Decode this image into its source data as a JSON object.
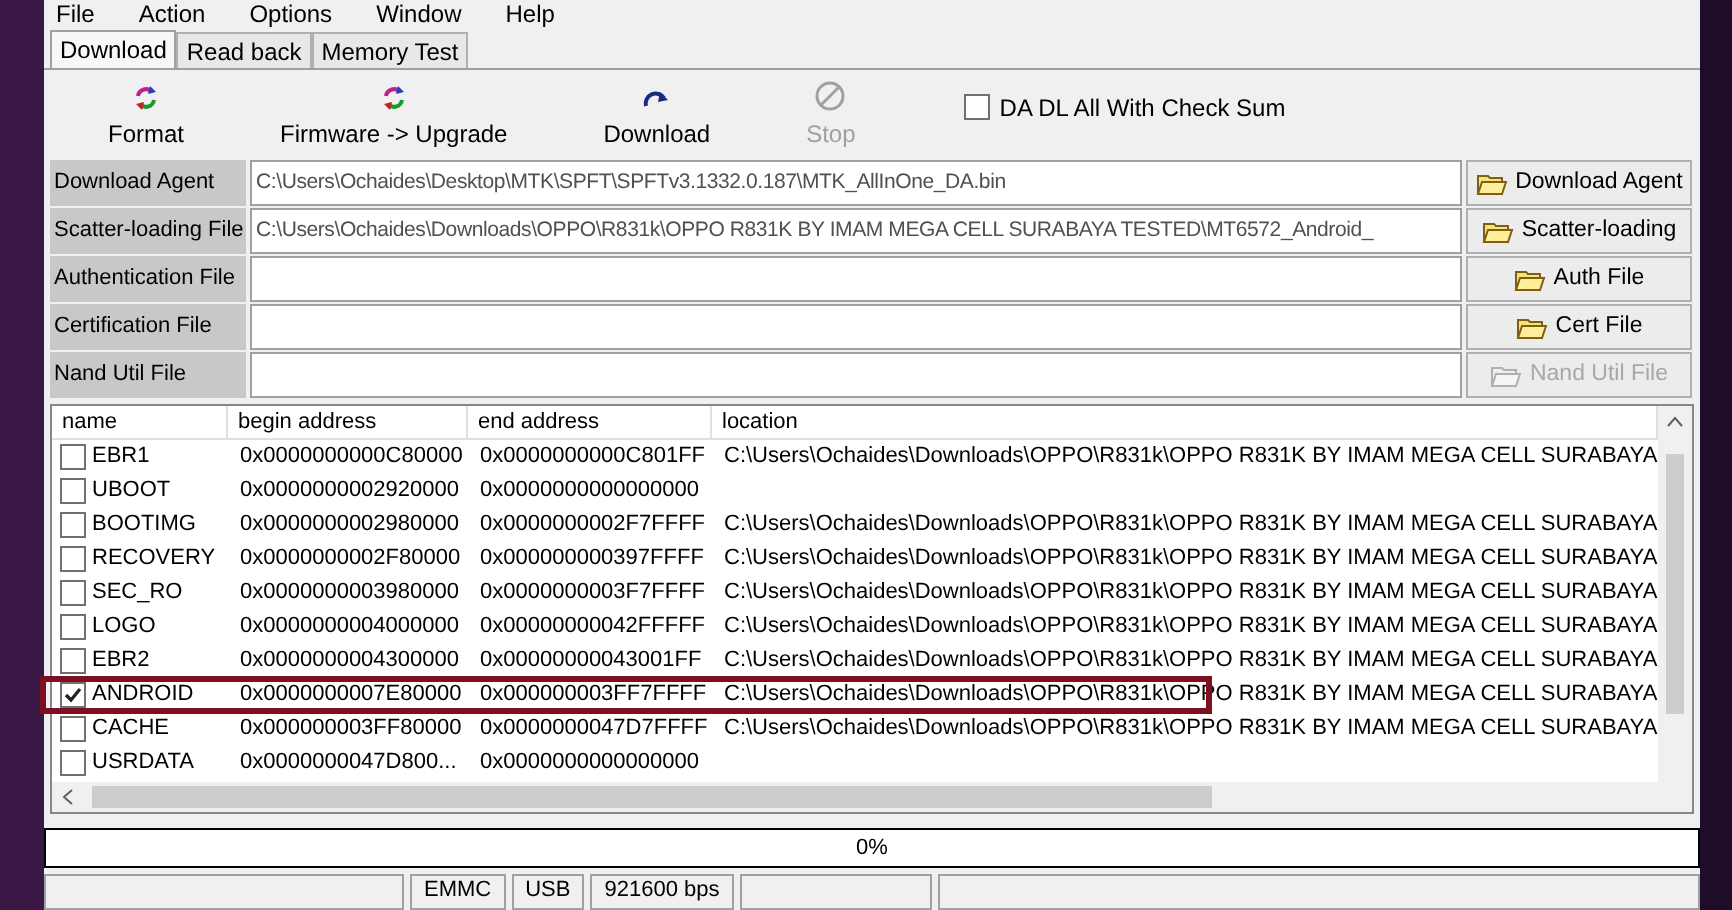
{
  "menu": [
    "File",
    "Action",
    "Options",
    "Window",
    "Help"
  ],
  "tabs": [
    {
      "label": "Download",
      "selected": true
    },
    {
      "label": "Read back",
      "selected": false
    },
    {
      "label": "Memory Test",
      "selected": false
    }
  ],
  "toolbar": {
    "buttons": [
      {
        "label": "Format",
        "kind": "cycle",
        "disabled": false
      },
      {
        "label": "Firmware -> Upgrade",
        "kind": "cycle",
        "disabled": false
      },
      {
        "label": "Download",
        "kind": "redo",
        "disabled": false
      },
      {
        "label": "Stop",
        "kind": "stop",
        "disabled": true
      }
    ],
    "checksum": {
      "label": "DA DL All With Check Sum",
      "checked": false
    }
  },
  "files": [
    {
      "label": "Download Agent",
      "value": "C:\\Users\\Ochaides\\Desktop\\MTK\\SPFT\\SPFTv3.1332.0.187\\MTK_AllInOne_DA.bin",
      "button": "Download Agent",
      "disabled": false
    },
    {
      "label": "Scatter-loading File",
      "value": "C:\\Users\\Ochaides\\Downloads\\OPPO\\R831k\\OPPO R831K BY IMAM MEGA CELL SURABAYA TESTED\\MT6572_Android_",
      "button": "Scatter-loading",
      "disabled": false
    },
    {
      "label": "Authentication File",
      "button": "Auth File",
      "disabled": false
    },
    {
      "label": "Certification File",
      "button": "Cert File",
      "disabled": false
    },
    {
      "label": "Nand Util File",
      "button": "Nand Util File",
      "disabled": true
    }
  ],
  "table": {
    "columns": [
      "name",
      "begin address",
      "end address",
      "location"
    ],
    "rows": [
      {
        "name": "EBR1",
        "checked": false,
        "highlighted": false,
        "begin": "0x0000000000C80000",
        "end": "0x0000000000C801FF",
        "location": "C:\\Users\\Ochaides\\Downloads\\OPPO\\R831k\\OPPO R831K BY IMAM MEGA CELL SURABAYA"
      },
      {
        "name": "UBOOT",
        "checked": false,
        "highlighted": false,
        "begin": "0x0000000002920000",
        "end": "0x0000000000000000"
      },
      {
        "name": "BOOTIMG",
        "checked": false,
        "highlighted": false,
        "begin": "0x0000000002980000",
        "end": "0x0000000002F7FFFF",
        "location": "C:\\Users\\Ochaides\\Downloads\\OPPO\\R831k\\OPPO R831K BY IMAM MEGA CELL SURABAYA"
      },
      {
        "name": "RECOVERY",
        "checked": false,
        "highlighted": false,
        "begin": "0x0000000002F80000",
        "end": "0x000000000397FFFF",
        "location": "C:\\Users\\Ochaides\\Downloads\\OPPO\\R831k\\OPPO R831K BY IMAM MEGA CELL SURABAYA"
      },
      {
        "name": "SEC_RO",
        "checked": false,
        "highlighted": false,
        "begin": "0x0000000003980000",
        "end": "0x0000000003F7FFFF",
        "location": "C:\\Users\\Ochaides\\Downloads\\OPPO\\R831k\\OPPO R831K BY IMAM MEGA CELL SURABAYA"
      },
      {
        "name": "LOGO",
        "checked": false,
        "highlighted": false,
        "begin": "0x0000000004000000",
        "end": "0x00000000042FFFFF",
        "location": "C:\\Users\\Ochaides\\Downloads\\OPPO\\R831k\\OPPO R831K BY IMAM MEGA CELL SURABAYA"
      },
      {
        "name": "EBR2",
        "checked": false,
        "highlighted": false,
        "begin": "0x0000000004300000",
        "end": "0x00000000043001FF",
        "location": "C:\\Users\\Ochaides\\Downloads\\OPPO\\R831k\\OPPO R831K BY IMAM MEGA CELL SURABAYA"
      },
      {
        "name": "ANDROID",
        "checked": true,
        "highlighted": true,
        "begin": "0x0000000007E80000",
        "end": "0x000000003FF7FFFF",
        "location": "C:\\Users\\Ochaides\\Downloads\\OPPO\\R831k\\OPPO R831K BY IMAM MEGA CELL SURABAYA"
      },
      {
        "name": "CACHE",
        "checked": false,
        "highlighted": false,
        "begin": "0x000000003FF80000",
        "end": "0x0000000047D7FFFF",
        "location": "C:\\Users\\Ochaides\\Downloads\\OPPO\\R831k\\OPPO R831K BY IMAM MEGA CELL SURABAYA"
      },
      {
        "name": "USRDATA",
        "checked": false,
        "highlighted": false,
        "begin": "0x0000000047D800...",
        "end": "0x0000000000000000"
      }
    ]
  },
  "progress": {
    "text": "0%",
    "level": 0
  },
  "status_bar": [
    "EMMC",
    "USB",
    "921600 bps"
  ]
}
